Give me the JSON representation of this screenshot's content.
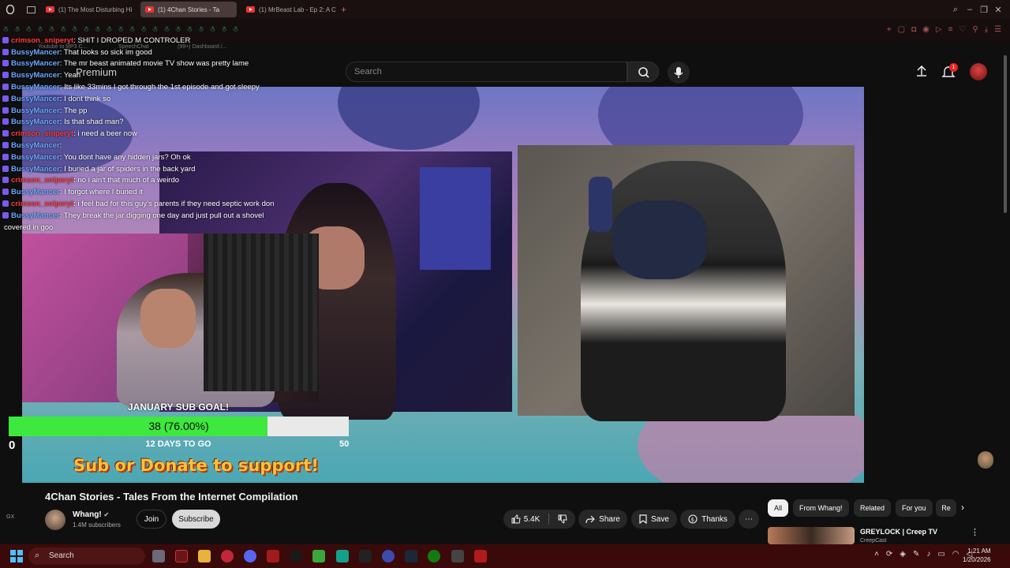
{
  "browser": {
    "tabs": [
      {
        "label": "(1) The Most Disturbing Hi",
        "active": false
      },
      {
        "label": "(1) 4Chan Stories - Ta",
        "active": true
      },
      {
        "label": "(1) MrBeast Lab - Ep 2: A C",
        "active": false
      }
    ],
    "new_tab": "+"
  },
  "bookmarks": [
    {
      "label": "Youtube to MP3 C..."
    },
    {
      "label": "SpeechChat"
    },
    {
      "label": "(99+) Dashboard /..."
    }
  ],
  "youtube": {
    "logo_text": "Premium",
    "search_placeholder": "Search",
    "notification_count": "1"
  },
  "chat": {
    "emote_row": "☃ ☃ ☃ ☃ ☃ ☃ ☃ ☃ ☃ ☃ ☃ ☃ ☃ ☃ ☃ ☃ ☃ ☃ ☃ ☃ ☃",
    "messages": [
      {
        "user": "crimson_sniperyt",
        "type": "c",
        "text": "SHIT I DROPED M CONTROLER"
      },
      {
        "user": "BussyMancer",
        "type": "b",
        "text": "That looks so sick im good"
      },
      {
        "user": "BussyMancer",
        "type": "b",
        "text": "The mr beast animated movie TV show was pretty lame"
      },
      {
        "user": "BussyMancer",
        "type": "b",
        "text": "Yeah"
      },
      {
        "user": "BussyMancer",
        "type": "b",
        "text": "Its like 33mins I got through the 1st episode and got sleepy"
      },
      {
        "user": "BussyMancer",
        "type": "b",
        "text": "I dont think so"
      },
      {
        "user": "BussyMancer",
        "type": "b",
        "text": "The pp"
      },
      {
        "user": "BussyMancer",
        "type": "b",
        "text": "Is that shad man?"
      },
      {
        "user": "crimson_sniperyt",
        "type": "c",
        "text": "i need a beer now"
      },
      {
        "user": "BussyMancer",
        "type": "b",
        "text": ""
      },
      {
        "user": "BussyMancer",
        "type": "b",
        "text": "You dont have any hidden jars? Oh ok"
      },
      {
        "user": "BussyMancer",
        "type": "b",
        "text": "I buried a jar of spiders in the back yard"
      },
      {
        "user": "crimson_sniperyt",
        "type": "c",
        "text": "no i ain't that much of a weirdo"
      },
      {
        "user": "BussyMancer",
        "type": "b",
        "text": "I forgot where I buried it"
      },
      {
        "user": "crimson_sniperyt",
        "type": "c",
        "text": "i feel bad for this guy's parents if they need septic work don"
      },
      {
        "user": "BussyMancer",
        "type": "b",
        "text": "They break the jar digging one day and just pull out a shovel"
      }
    ],
    "continuation": "covered in goo"
  },
  "sub_goal": {
    "title": "JANUARY SUB GOAL!",
    "progress_text": "38 (76.00%)",
    "progress_fraction": 0.76,
    "min": "0",
    "max": "50",
    "days_left": "12 DAYS TO GO",
    "support_banner": "Sub or Donate to support!"
  },
  "video": {
    "title": "4Chan Stories - Tales From the Internet Compilation",
    "channel": "Whang!",
    "subscribers": "1.4M subscribers",
    "join": "Join",
    "subscribe": "Subscribe",
    "likes": "5.4K",
    "share": "Share",
    "save": "Save",
    "thanks": "Thanks"
  },
  "recommend_chips": [
    "All",
    "From Whang!",
    "Related",
    "For you",
    "Re"
  ],
  "recommended": {
    "title": "GREYLOCK | Creep TV",
    "subtitle": "CreepCast"
  },
  "side_label": "GX",
  "taskbar": {
    "search_placeholder": "Search",
    "time": "1:21 AM",
    "date": "1/20/2026"
  },
  "colors": {
    "goal_fill": "#3ee83e",
    "chat_user_b": "#6ba8ff",
    "chat_user_c": "#ff3b3b",
    "taskbar": "#3a0a0a"
  }
}
